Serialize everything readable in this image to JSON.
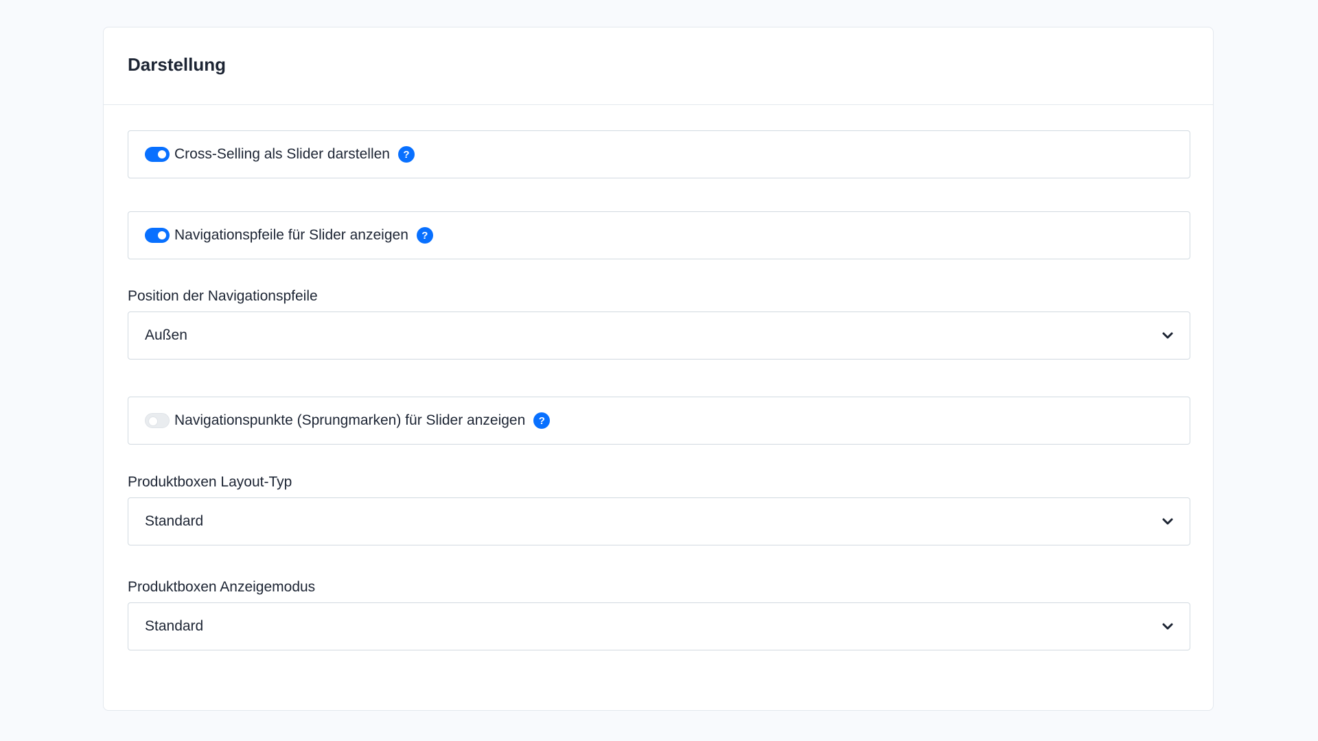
{
  "card": {
    "title": "Darstellung"
  },
  "fields": {
    "cross_selling_slider": {
      "label": "Cross-Selling als Slider darstellen",
      "enabled": true,
      "help_icon": "question-circle-icon"
    },
    "nav_arrows": {
      "label": "Navigationspfeile für Slider anzeigen",
      "enabled": true,
      "help_icon": "question-circle-icon"
    },
    "nav_arrow_position": {
      "label": "Position der Navigationspfeile",
      "value": "Außen",
      "icon": "chevron-down-icon"
    },
    "nav_dots": {
      "label": "Navigationspunkte (Sprungmarken) für Slider anzeigen",
      "enabled": false,
      "help_icon": "question-circle-icon"
    },
    "productbox_layout": {
      "label": "Produktboxen Layout-Typ",
      "value": "Standard",
      "icon": "chevron-down-icon"
    },
    "productbox_display_mode": {
      "label": "Produktboxen Anzeigemodus",
      "value": "Standard",
      "icon": "chevron-down-icon"
    }
  },
  "help_glyph": "?",
  "colors": {
    "accent": "#0870ff",
    "background": "#f8fafd",
    "border": "#d1d9e0",
    "text": "#1c2433"
  }
}
